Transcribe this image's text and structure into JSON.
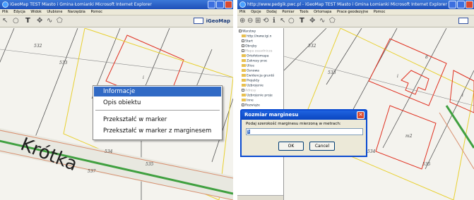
{
  "left": {
    "title": "iGeoMap  TEST Miasto i Gmina Łomianki  Microsoft Internet Explorer",
    "menu": [
      "Plik",
      "Edycja",
      "Widok",
      "Ulubione",
      "Narzędzia",
      "Pomoc"
    ],
    "brand": "iGeoMap",
    "parcels": [
      "532",
      "533",
      "i",
      "534",
      "537",
      "535"
    ],
    "street": "Krótka",
    "context_menu": {
      "items": [
        "Informacje",
        "Opis obiektu",
        "Przekształć w marker",
        "Przekształć w marker z marginesem"
      ],
      "active_index": 0
    }
  },
  "right": {
    "title": "http://www.pedgik.pwc.pl - iGeoMap  TEST Miasto i Gmina Łomianki  Microsoft Internet Explorer",
    "menu": [
      "Plik",
      "Opcje",
      "Dodaj",
      "Pomiar",
      "Tools",
      "Ortomapa",
      "Prace geodezyjne",
      "Pomoc"
    ],
    "tree": {
      "items": [
        "Warstwy",
        "http://www.igi.n",
        "Start",
        "Obręby",
        "Mapa zasadnicza",
        "Ortofotomapa",
        "Zakresy prac",
        "Ulice",
        "Osnowa",
        "Ewidencja gruntó",
        "Projekty",
        "Uzbrojenie",
        "Adresy",
        "Uzbrojenie proje",
        "Inne",
        "Rozwiąże"
      ],
      "faded": [
        4,
        12
      ]
    },
    "parcels": [
      "532",
      "533",
      "8",
      "i",
      "i",
      "m2",
      "534",
      "535"
    ],
    "dialog": {
      "title": "Rozmiar marginesu",
      "prompt": "Podaj szerokość marginesu mierzoną w metrach:",
      "value": "5",
      "ok": "OK",
      "cancel": "Cancel"
    }
  }
}
